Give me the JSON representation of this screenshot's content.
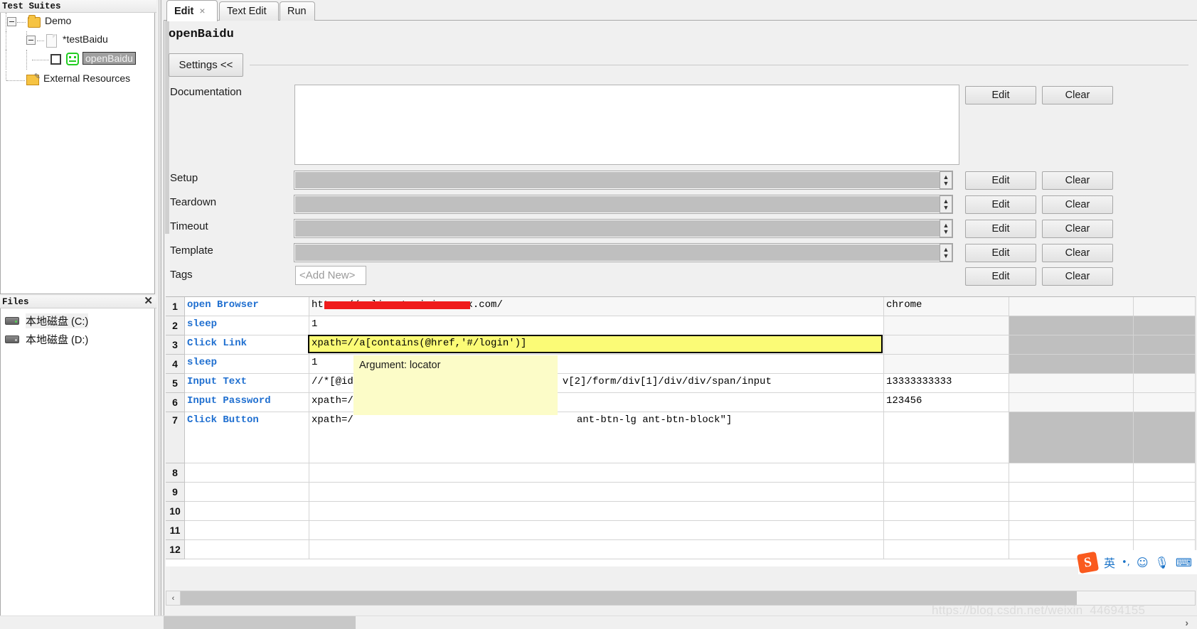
{
  "left": {
    "test_suites_title": "Test Suites",
    "tree": [
      {
        "label": "Demo",
        "icon": "folder-icon"
      },
      {
        "label": "*testBaidu",
        "icon": "file-icon"
      },
      {
        "label": "openBaidu",
        "icon": "keyword-icon",
        "selected": true
      },
      {
        "label": "External Resources",
        "icon": "resource-folder-icon"
      }
    ],
    "files_title": "Files",
    "files_close": "✕",
    "files": [
      {
        "label_cn": "本地磁盘",
        "label_suffix": " (C:)"
      },
      {
        "label_cn": "本地磁盘",
        "label_suffix": " (D:)"
      }
    ]
  },
  "tabs": [
    {
      "label": "Edit",
      "active": true,
      "close": "×"
    },
    {
      "label": "Text Edit",
      "active": false
    },
    {
      "label": "Run",
      "active": false
    }
  ],
  "editor": {
    "keyword_title": "openBaidu",
    "settings_button": "Settings <<",
    "fields": [
      {
        "label": "Documentation",
        "value": "",
        "edit": "Edit",
        "clear": "Clear"
      },
      {
        "label": "Setup",
        "value": "",
        "edit": "Edit",
        "clear": "Clear"
      },
      {
        "label": "Teardown",
        "value": "",
        "edit": "Edit",
        "clear": "Clear"
      },
      {
        "label": "Timeout",
        "value": "",
        "edit": "Edit",
        "clear": "Clear"
      },
      {
        "label": "Template",
        "value": "",
        "edit": "Edit",
        "clear": "Clear"
      },
      {
        "label": "Tags",
        "value": "<Add New>",
        "edit": "Edit",
        "clear": "Clear"
      }
    ]
  },
  "grid": {
    "rows": [
      {
        "n": "1",
        "c0": "open Browser",
        "c1": "https://online-training-xxx.com/",
        "c1_redacted": true,
        "c2": "chrome",
        "c3": "",
        "c4": ""
      },
      {
        "n": "2",
        "c0": "sleep",
        "c1": "1",
        "c2": "",
        "c3": "",
        "c4": ""
      },
      {
        "n": "3",
        "c0": "Click Link",
        "c1": "xpath=//a[contains(@href,'#/login')]",
        "c2": "",
        "c3": "",
        "c4": "",
        "selected": true
      },
      {
        "n": "4",
        "c0": "sleep",
        "c1": "1",
        "c2": "",
        "c3": "",
        "c4": ""
      },
      {
        "n": "5",
        "c0": "Input Text",
        "c1": "//*[@id=...]/div[2]/form/div[1]/div/div/span/input",
        "c1_head": "//*[@id",
        "c1_tail": "v[2]/form/div[1]/div/div/span/input",
        "c2": "13333333333",
        "c3": "",
        "c4": ""
      },
      {
        "n": "6",
        "c0": "Input Password",
        "c1": "xpath=/...",
        "c1_head": "xpath=/",
        "c1_tail": "",
        "c2": "123456",
        "c3": "",
        "c4": ""
      },
      {
        "n": "7",
        "c0": "Click Button",
        "c1": "xpath=//*[@class=\"ant-btn ant-btn-primary ant-btn-lg ant-btn-block\"]",
        "c1_head": "xpath=/",
        "c1_tail": "ant-btn-lg ant-btn-block\"]",
        "c2": "",
        "c3": "",
        "c4": ""
      },
      {
        "n": "8",
        "c0": "",
        "c1": "",
        "c2": "",
        "c3": "",
        "c4": ""
      },
      {
        "n": "9",
        "c0": "",
        "c1": "",
        "c2": "",
        "c3": "",
        "c4": ""
      },
      {
        "n": "10",
        "c0": "",
        "c1": "",
        "c2": "",
        "c3": "",
        "c4": ""
      },
      {
        "n": "11",
        "c0": "",
        "c1": "",
        "c2": "",
        "c3": "",
        "c4": ""
      },
      {
        "n": "12",
        "c0": "",
        "c1": "",
        "c2": "",
        "c3": "",
        "c4": ""
      }
    ],
    "tooltip": "Argument: locator",
    "selected_cell_text": "xpath=//a[contains(@href,'#/login')]"
  },
  "scroll": {
    "left_arrow": "‹",
    "right_arrow": "›"
  },
  "ime": {
    "logo": "S",
    "items": [
      "英",
      "•,",
      "☺",
      "🎙",
      "⌨"
    ]
  },
  "watermark": "https://blog.csdn.net/weixin_44694155",
  "colors": {
    "keyword_blue": "#1f6fd0",
    "selection_yellow": "#fbfb76",
    "tooltip_yellow": "#fcfcc8",
    "redaction_red": "#ef1b1b",
    "tree_selected_bg": "#a0a0a0"
  }
}
